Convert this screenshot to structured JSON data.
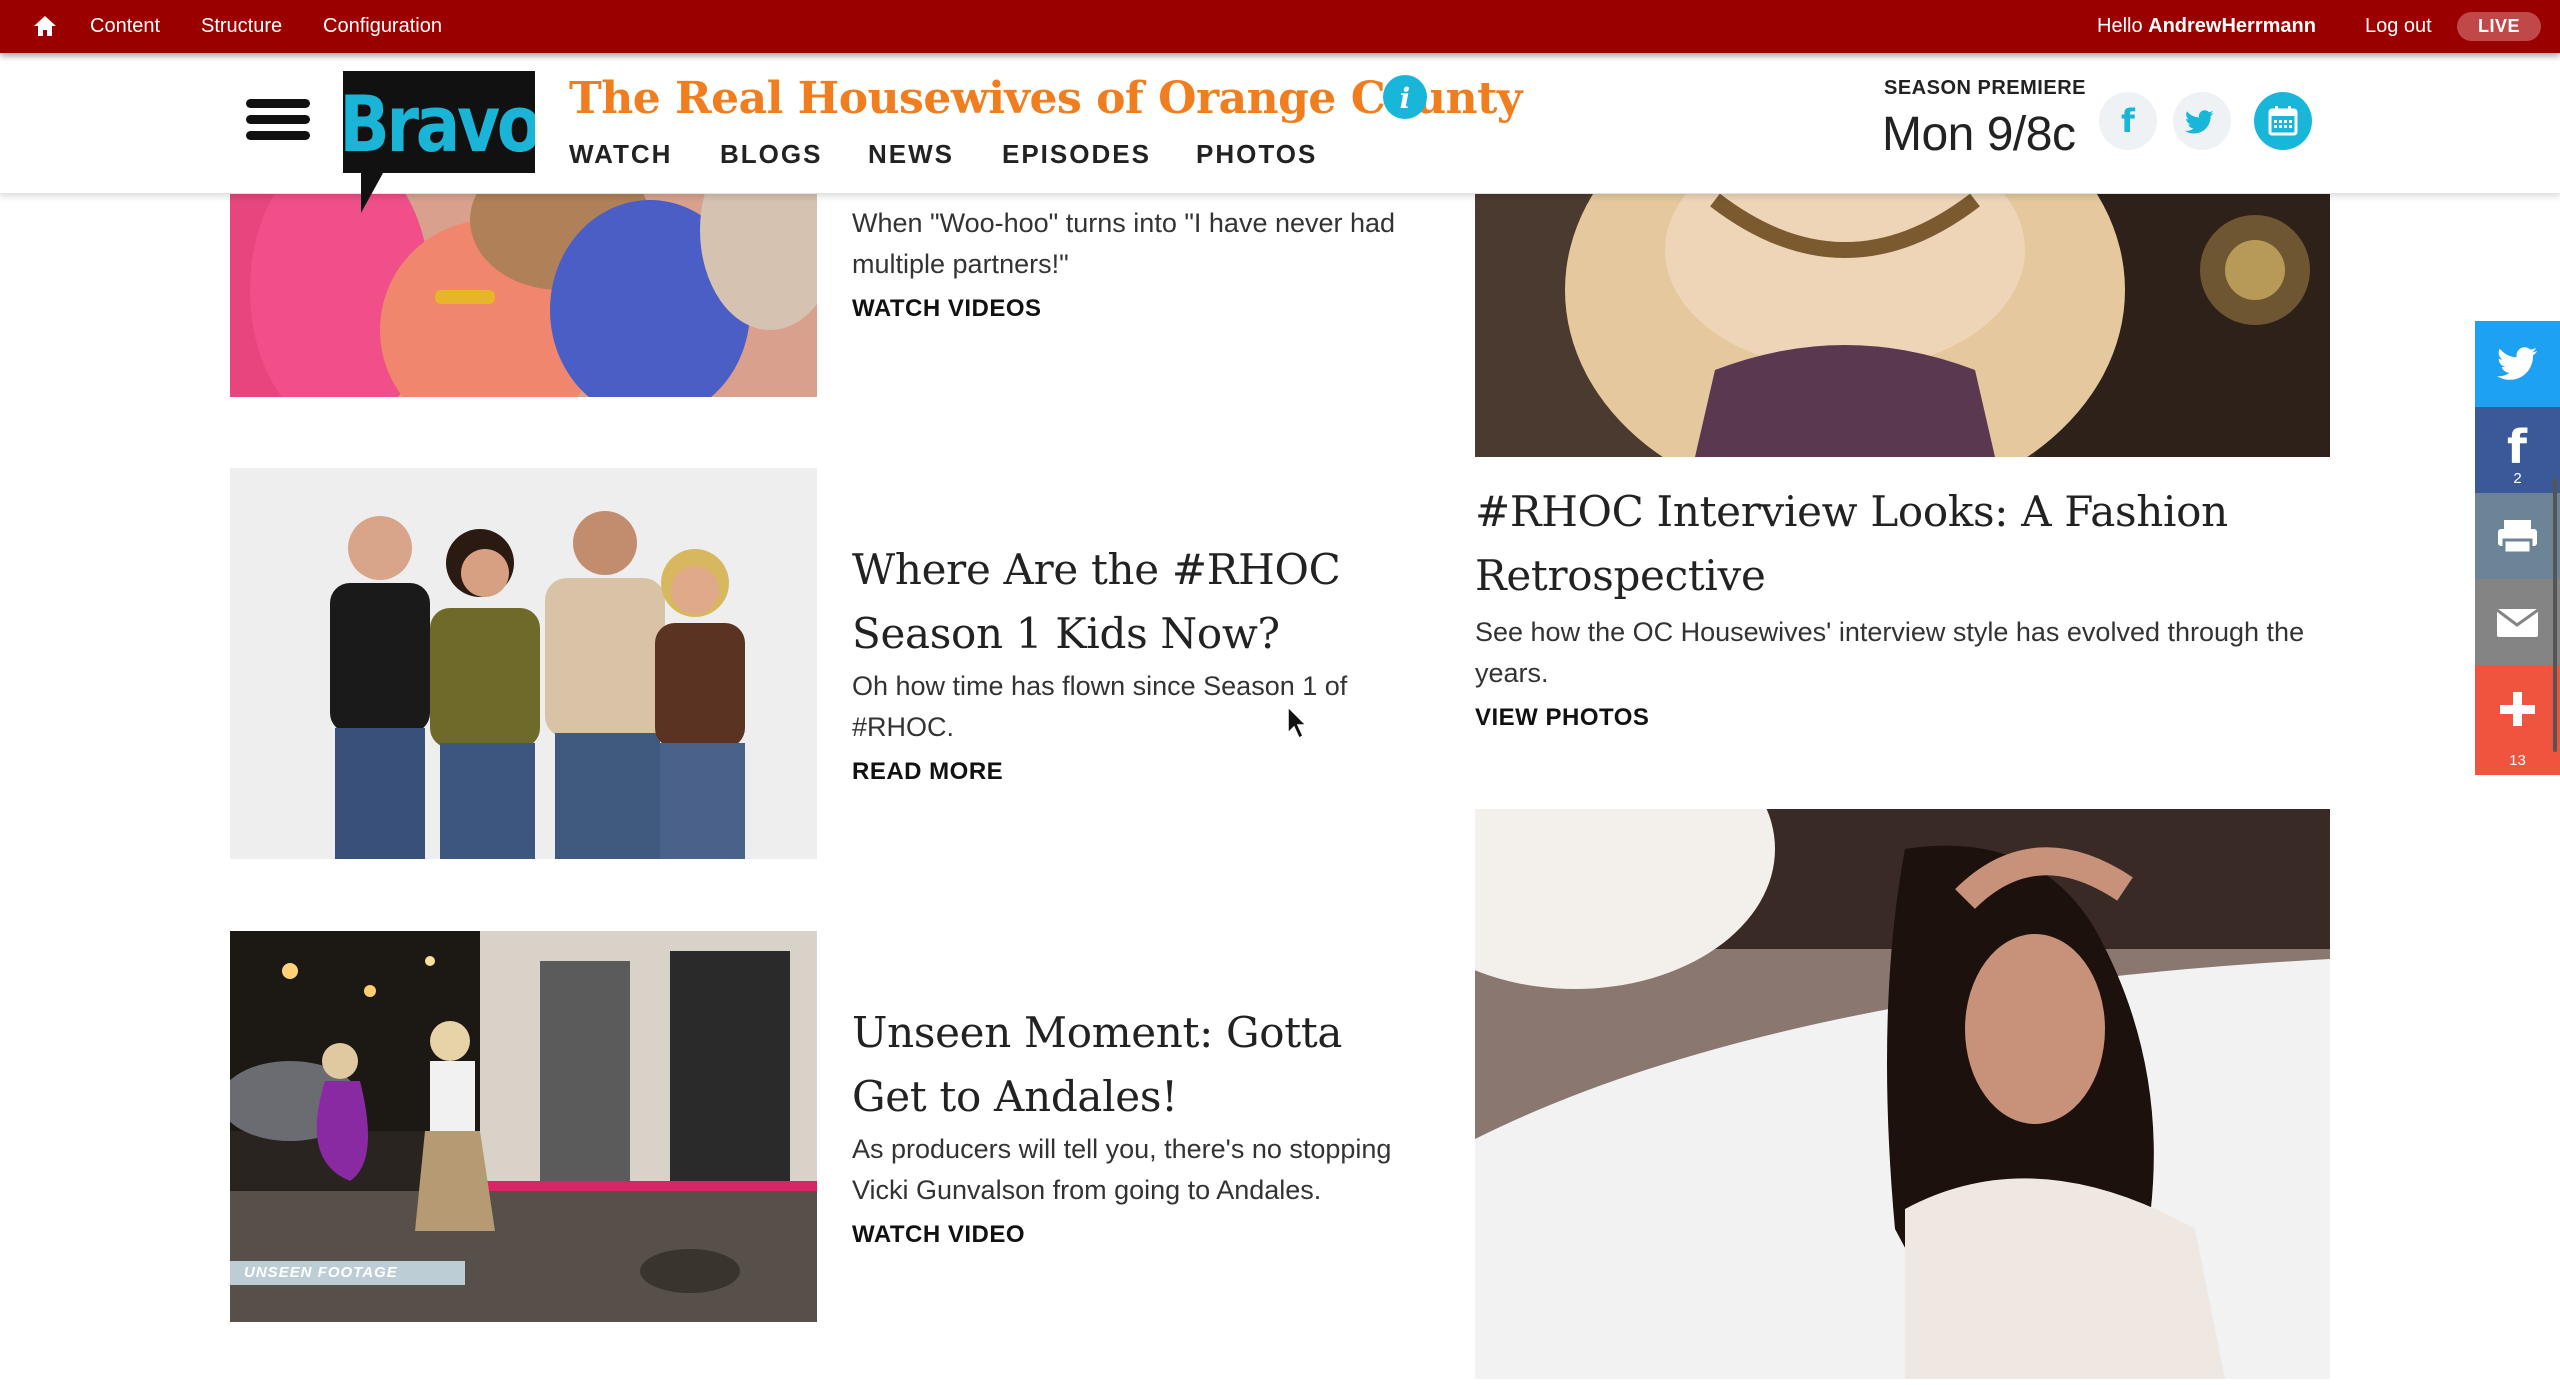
{
  "admin_bar": {
    "links": [
      "Content",
      "Structure",
      "Configuration"
    ],
    "greeting": "Hello",
    "username": "AndrewHerrmann",
    "logout": "Log out",
    "live_badge": "LIVE",
    "bar_color": "#9b0000"
  },
  "header": {
    "logo_text": "Bravo",
    "show_title": "The Real Housewives of Orange County",
    "nav": [
      "WATCH",
      "BLOGS",
      "NEWS",
      "EPISODES",
      "PHOTOS"
    ],
    "season_premiere_label": "SEASON PREMIERE",
    "premiere_time": "Mon 9/8c",
    "title_color": "#f07d1e",
    "accent_color": "#18b7d9"
  },
  "stories_left": [
    {
      "description": "When \"Woo-hoo\" turns into \"I have never had multiple partners!\"",
      "cta": "WATCH VIDEOS"
    },
    {
      "title": "Where Are the #RHOC Season 1 Kids Now?",
      "description": "Oh how time has flown since Season 1 of #RHOC.",
      "cta": "READ MORE"
    },
    {
      "title": "Unseen Moment: Gotta Get to Andales!",
      "description": "As producers will tell you, there's no stopping Vicki Gunvalson from going to Andales.",
      "cta": "WATCH VIDEO",
      "image_caption": "UNSEEN FOOTAGE"
    }
  ],
  "stories_right": [
    {
      "title": "#RHOC Interview Looks: A Fashion Retrospective",
      "description": "See how the OC Housewives' interview style has evolved through the years.",
      "cta": "VIEW PHOTOS"
    }
  ],
  "share_rail": {
    "facebook_count": "2",
    "more_count": "13",
    "colors": {
      "twitter": "#1da1f2",
      "facebook": "#3b5998",
      "print": "#6d8496",
      "email": "#848484",
      "more": "#f0533e"
    }
  }
}
